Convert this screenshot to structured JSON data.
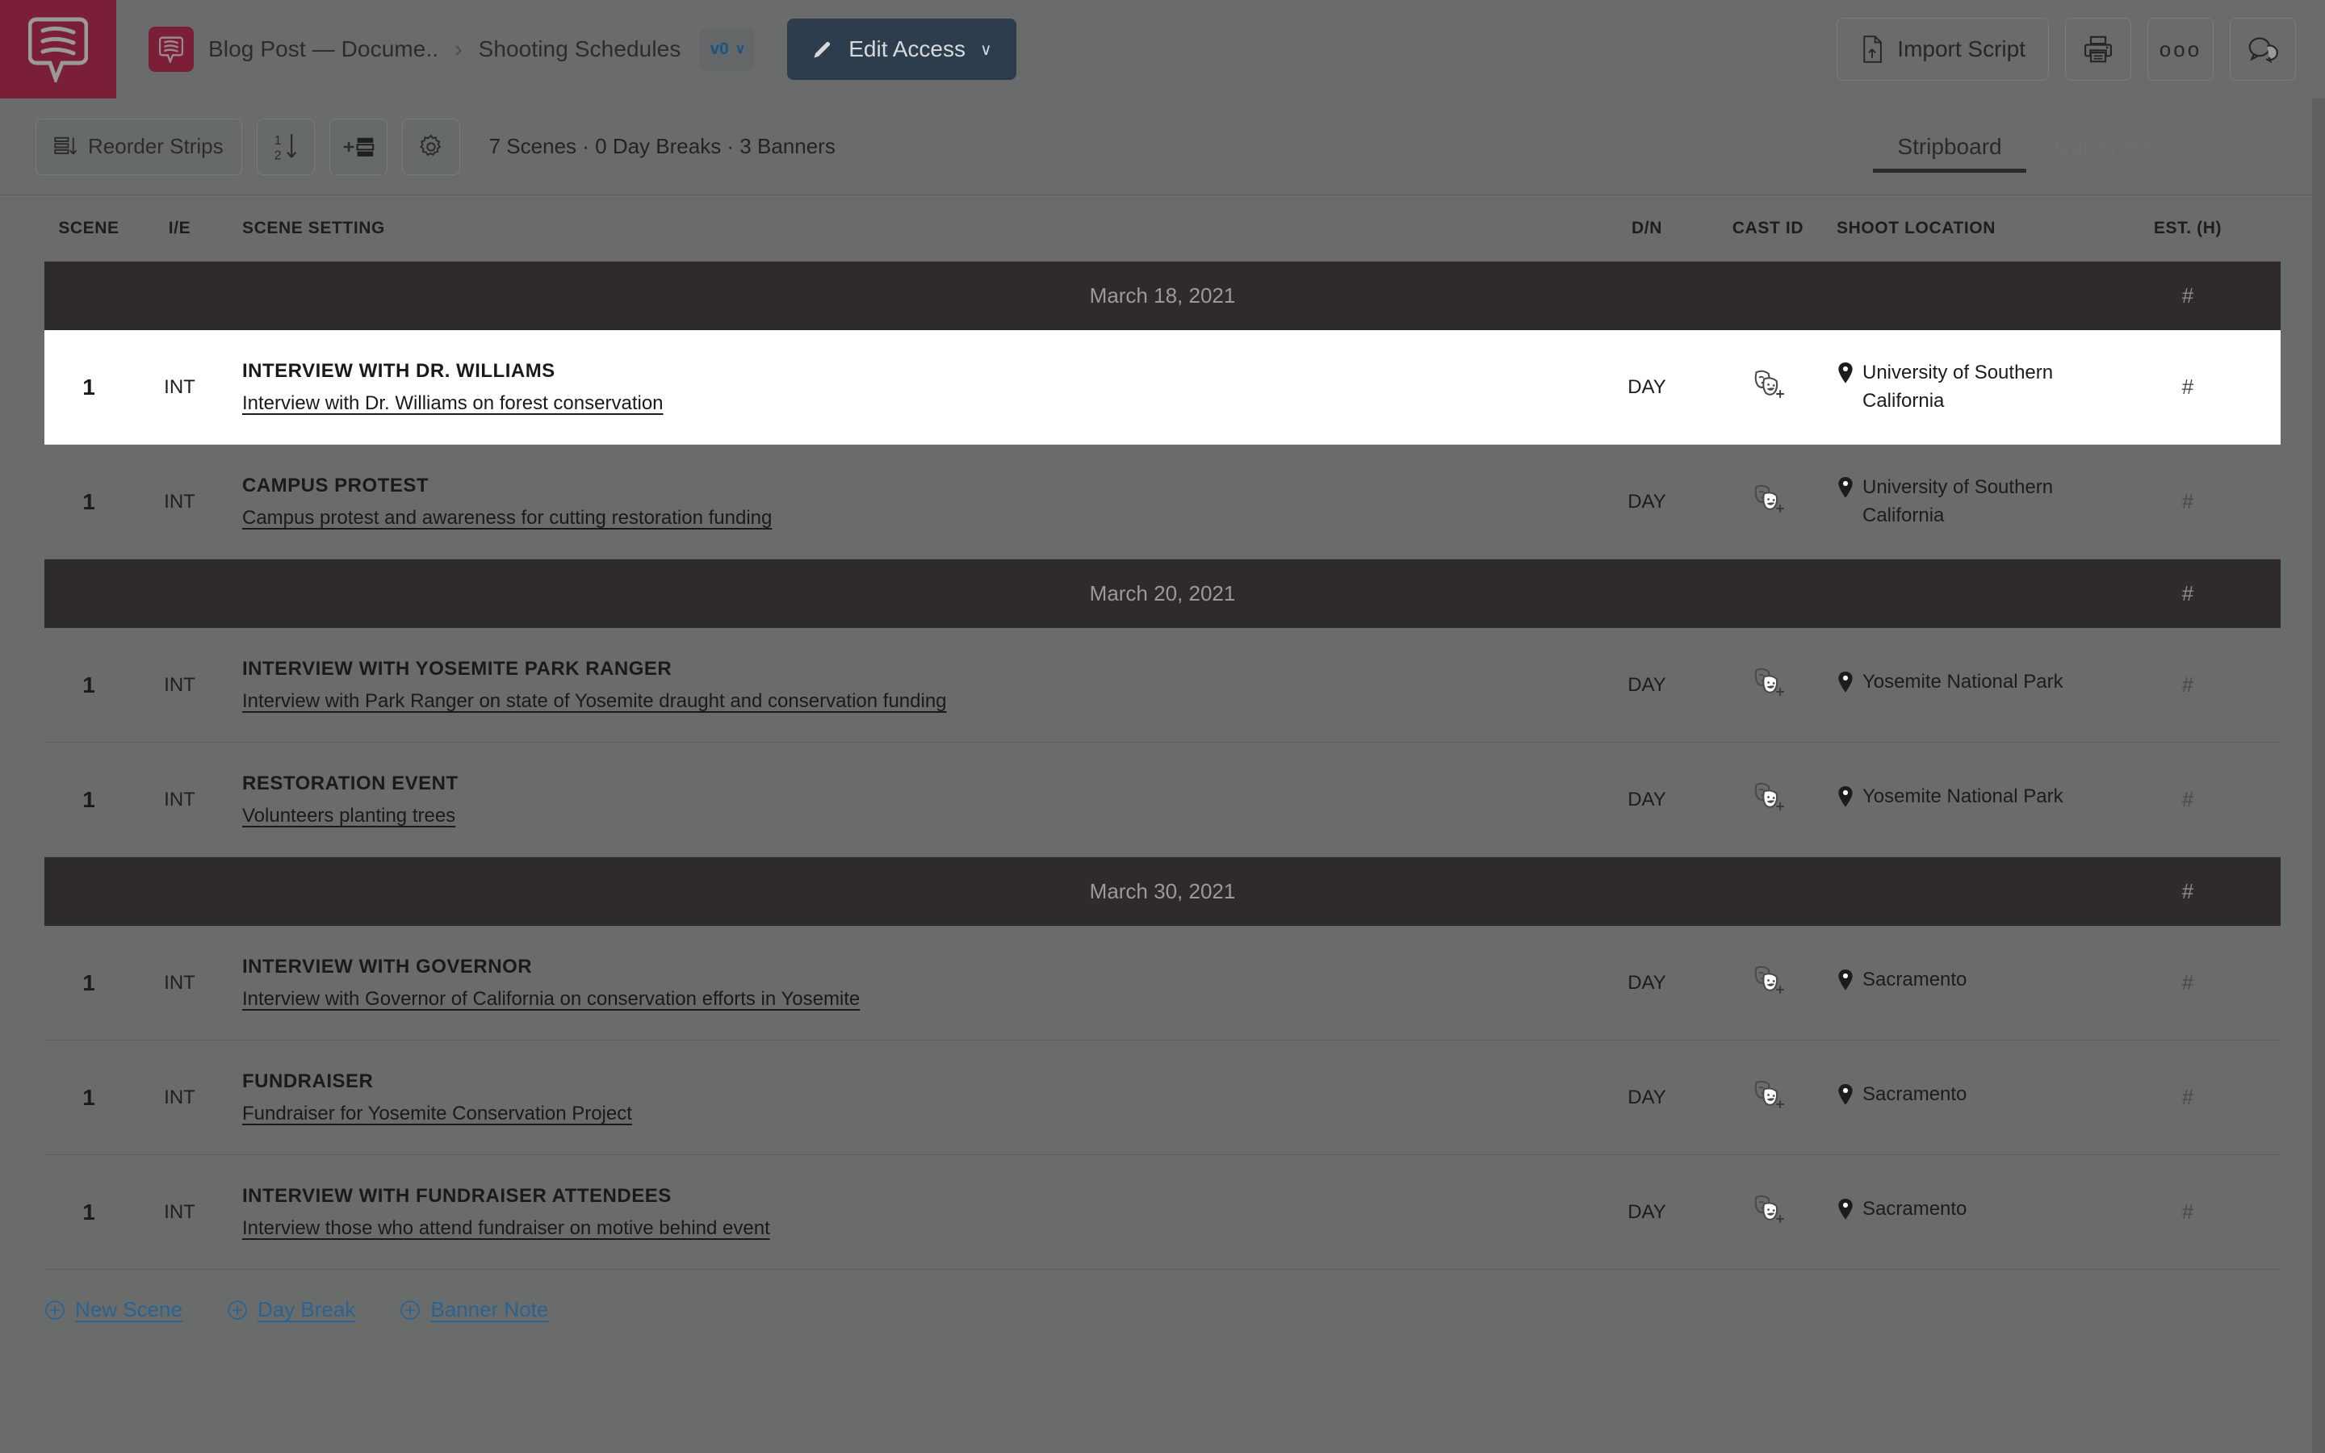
{
  "app": {
    "logo_icon": "celtx-speech-bubble-logo",
    "brand_color": "#7a1f37"
  },
  "header": {
    "doc_icon": "document-speech-bubble-icon",
    "breadcrumb": [
      "Blog Post — Docume..",
      "Shooting Schedules"
    ],
    "breadcrumb_separator": "›",
    "version_badge": "v0",
    "version_chevron": "∨",
    "edit_access_label": "Edit Access",
    "edit_access_icon": "pencil-icon",
    "edit_access_chevron": "∨",
    "actions": [
      {
        "name": "import-script-button",
        "label": "Import Script",
        "icon": "file-upload-icon"
      },
      {
        "name": "print-button",
        "label": "",
        "icon": "printer-icon"
      },
      {
        "name": "more-options-button",
        "label": "ooo",
        "icon": "ellipsis-icon"
      },
      {
        "name": "comments-button",
        "label": "",
        "icon": "comment-bubbles-icon"
      }
    ]
  },
  "toolbar": {
    "reorder_label": "Reorder Strips",
    "reorder_icon": "reorder-list-down-icon",
    "sort_icon": "sort-one-two-down-icon",
    "add_strip_icon": "add-strip-icon",
    "settings_icon": "gear-icon",
    "stats": "7 Scenes · 0 Day Breaks · 3 Banners",
    "tabs": [
      {
        "name": "tab-stripboard",
        "label": "Stripboard",
        "active": true
      },
      {
        "name": "tab-boneyard",
        "label": "Boneyard",
        "active": false
      }
    ]
  },
  "table": {
    "columns": {
      "scene": "SCENE",
      "ie": "I/E",
      "setting": "SCENE SETTING",
      "dn": "D/N",
      "cast": "CAST ID",
      "location": "SHOOT LOCATION",
      "est": "EST. (H)"
    },
    "blocks": [
      {
        "banner": {
          "label": "March 18, 2021",
          "est": "#"
        },
        "scenes": [
          {
            "scene": "1",
            "ie": "INT",
            "heading": "INTERVIEW WITH DR. WILLIAMS",
            "description": "Interview with Dr. Williams on forest conservation",
            "dn": "DAY",
            "cast_icon": "theater-masks-add-icon",
            "location": "University of Southern California",
            "est": "#",
            "selected": true
          },
          {
            "scene": "1",
            "ie": "INT",
            "heading": "CAMPUS PROTEST",
            "description": "Campus protest and awareness for cutting restoration funding",
            "dn": "DAY",
            "cast_icon": "theater-masks-add-icon",
            "location": "University of Southern California",
            "est": "#",
            "selected": false
          }
        ]
      },
      {
        "banner": {
          "label": "March 20, 2021",
          "est": "#"
        },
        "scenes": [
          {
            "scene": "1",
            "ie": "INT",
            "heading": "INTERVIEW WITH YOSEMITE PARK RANGER",
            "description": "Interview with Park Ranger on state of Yosemite draught and conservation funding",
            "dn": "DAY",
            "cast_icon": "theater-masks-add-icon",
            "location": "Yosemite National Park",
            "est": "#",
            "selected": false
          },
          {
            "scene": "1",
            "ie": "INT",
            "heading": "RESTORATION EVENT",
            "description": "Volunteers planting trees ",
            "dn": "DAY",
            "cast_icon": "theater-masks-add-icon",
            "location": "Yosemite National Park",
            "est": "#",
            "selected": false
          }
        ]
      },
      {
        "banner": {
          "label": "March 30, 2021",
          "est": "#"
        },
        "scenes": [
          {
            "scene": "1",
            "ie": "INT",
            "heading": "INTERVIEW WITH GOVERNOR",
            "description": "Interview with Governor of California on conservation efforts in Yosemite",
            "dn": "DAY",
            "cast_icon": "theater-masks-add-icon",
            "location": "Sacramento",
            "est": "#",
            "selected": false
          },
          {
            "scene": "1",
            "ie": "INT",
            "heading": "FUNDRAISER",
            "description": "Fundraiser for Yosemite Conservation Project",
            "dn": "DAY",
            "cast_icon": "theater-masks-add-icon",
            "location": "Sacramento",
            "est": "#",
            "selected": false
          },
          {
            "scene": "1",
            "ie": "INT",
            "heading": "INTERVIEW WITH FUNDRAISER ATTENDEES",
            "description": "Interview those who attend fundraiser on motive behind event",
            "dn": "DAY",
            "cast_icon": "theater-masks-add-icon",
            "location": "Sacramento",
            "est": "#",
            "selected": false
          }
        ]
      }
    ]
  },
  "footer_actions": [
    {
      "name": "new-scene-link",
      "label": "New Scene",
      "icon": "plus-circle-icon"
    },
    {
      "name": "day-break-link",
      "label": "Day Break",
      "icon": "plus-circle-icon"
    },
    {
      "name": "banner-note-link",
      "label": "Banner Note",
      "icon": "plus-circle-icon"
    }
  ],
  "colors": {
    "brand_maroon": "#7a1f37",
    "overlay_gray": "#6a6c6c",
    "banner_dark": "#2f2b2a",
    "edit_access_navy": "#2e3d4d",
    "link_blue": "#2a6391",
    "selected_row": "#ffffff"
  }
}
